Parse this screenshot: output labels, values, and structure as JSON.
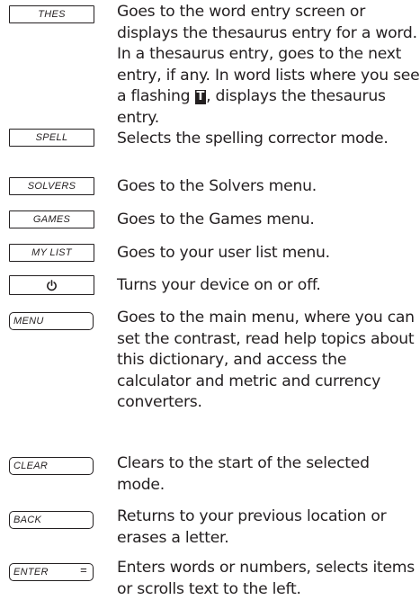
{
  "keys": {
    "thes": "THES",
    "spell": "SPELL",
    "solvers": "SOLVERS",
    "games": "GAMES",
    "mylist": "MY LIST",
    "menu": "MENU",
    "clear": "CLEAR",
    "back": "BACK",
    "enter": "ENTER",
    "enter_symbol": "="
  },
  "descriptions": {
    "thes_part1": "Goes to the word entry screen or displays the thesaurus entry for a word. In a thesaurus entry, goes to the next entry, if any. In word lists where you see a flashing",
    "thes_flash_icon": "T",
    "thes_part2": ", displays the thesaurus entry.",
    "spell": "Selects the spelling corrector mode.",
    "solvers": "Goes to the Solvers menu.",
    "games": "Goes to the Games menu.",
    "mylist": "Goes to your user list menu.",
    "power": "Turns your device on or off.",
    "menu": "Goes to the main menu, where you can set the contrast, read help topics about this dictionary, and access the calculator and metric and currency converters.",
    "clear": "Clears to the start of the selected mode.",
    "back": "Returns to your previous location or erases a letter.",
    "enter": "Enters words or numbers, selects items or scrolls text to the left."
  },
  "icons": {
    "power": "power-icon",
    "flashing_t": "flashing-t-icon"
  },
  "colors": {
    "text": "#231f20",
    "background": "#ffffff"
  }
}
